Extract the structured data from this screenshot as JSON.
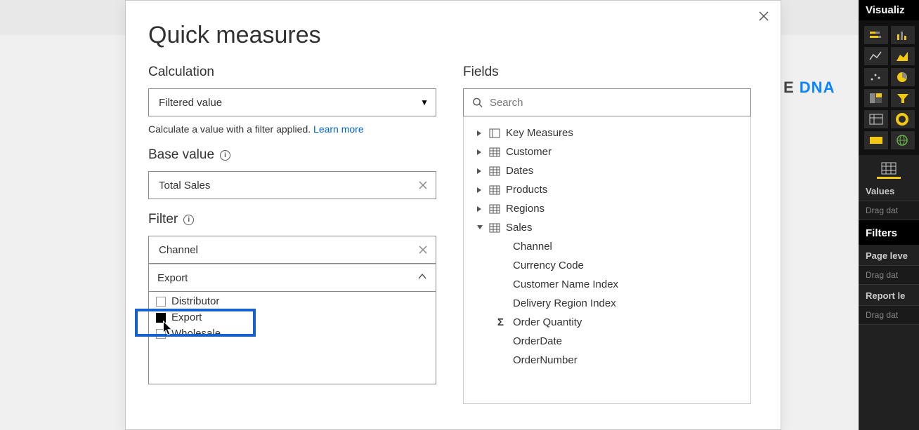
{
  "bg_logo": {
    "seg1": "E ",
    "seg2": "DNA"
  },
  "dialog": {
    "title": "Quick measures",
    "calculation_label": "Calculation",
    "calculation_value": "Filtered value",
    "help_text": "Calculate a value with a filter applied.  ",
    "learn_more": "Learn more",
    "base_value_label": "Base value",
    "base_value_value": "Total Sales",
    "filter_label": "Filter",
    "filter_value": "Channel",
    "filter_selection": "Export",
    "filter_options": [
      {
        "label": "Distributor",
        "checked": false
      },
      {
        "label": "Export",
        "checked": true
      },
      {
        "label": "Wholesale",
        "checked": false
      }
    ]
  },
  "fields": {
    "label": "Fields",
    "search_placeholder": "Search",
    "tree": [
      {
        "name": "Key Measures",
        "expanded": false,
        "icon": "measure"
      },
      {
        "name": "Customer",
        "expanded": false,
        "icon": "table"
      },
      {
        "name": "Dates",
        "expanded": false,
        "icon": "table"
      },
      {
        "name": "Products",
        "expanded": false,
        "icon": "table"
      },
      {
        "name": "Regions",
        "expanded": false,
        "icon": "table"
      },
      {
        "name": "Sales",
        "expanded": true,
        "icon": "table",
        "children": [
          {
            "name": "Channel",
            "sigma": false
          },
          {
            "name": "Currency Code",
            "sigma": false
          },
          {
            "name": "Customer Name Index",
            "sigma": false
          },
          {
            "name": "Delivery Region Index",
            "sigma": false
          },
          {
            "name": "Order Quantity",
            "sigma": true
          },
          {
            "name": "OrderDate",
            "sigma": false
          },
          {
            "name": "OrderNumber",
            "sigma": false
          }
        ]
      }
    ]
  },
  "viz": {
    "title": "Visualiz",
    "values_label": "Values",
    "drag_hint": "Drag dat",
    "filters_label": "Filters",
    "page_level_label": "Page leve",
    "report_level_label": "Report le",
    "accent": "#f2c811"
  }
}
